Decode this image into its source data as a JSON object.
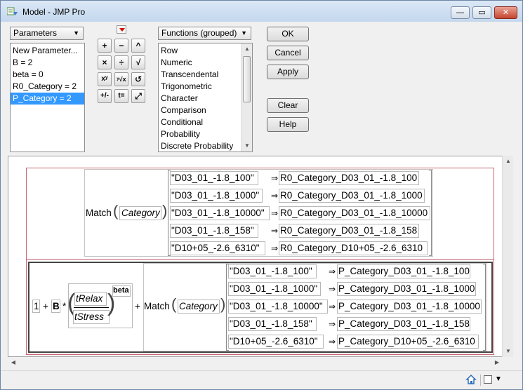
{
  "window": {
    "title": "Model - JMP Pro",
    "minimize": "—",
    "maximize": "▭",
    "close": "✕"
  },
  "left_panel": {
    "dropdown": "Parameters",
    "items": [
      "New Parameter...",
      "B = 2",
      "beta = 0",
      "R0_Category = 2",
      "P_Category = 2"
    ],
    "selected_index": 4
  },
  "functions_panel": {
    "dropdown": "Functions (grouped)",
    "items": [
      "Row",
      "Numeric",
      "Transcendental",
      "Trigonometric",
      "Character",
      "Comparison",
      "Conditional",
      "Probability",
      "Discrete Probability"
    ]
  },
  "toolbar": {
    "buttons": [
      "+",
      "−",
      "^",
      "×",
      "÷",
      "√",
      "xʸ",
      "ʸ√x",
      "↺",
      "+/-",
      "t=",
      "⤢"
    ]
  },
  "buttons": {
    "ok": "OK",
    "cancel": "Cancel",
    "apply": "Apply",
    "clear": "Clear",
    "help": "Help"
  },
  "formula": {
    "match_label": "Match",
    "category_column": "Category",
    "arrow": "⇒",
    "match1": [
      {
        "key": "\"D03_01_-1.8_100\"",
        "value": "R0_Category_D03_01_-1.8_100"
      },
      {
        "key": "\"D03_01_-1.8_1000\"",
        "value": "R0_Category_D03_01_-1.8_1000"
      },
      {
        "key": "\"D03_01_-1.8_10000\"",
        "value": "R0_Category_D03_01_-1.8_10000"
      },
      {
        "key": "\"D03_01_-1.8_158\"",
        "value": "R0_Category_D03_01_-1.8_158"
      },
      {
        "key": "\"D10+05_-2.6_6310\"",
        "value": "R0_Category_D10+05_-2.6_6310"
      }
    ],
    "one": "1",
    "plus": "+",
    "b_param": "B",
    "times": "*",
    "numerator": "tRelax",
    "denominator": "tStress",
    "exponent": "beta",
    "match2": [
      {
        "key": "\"D03_01_-1.8_100\"",
        "value": "P_Category_D03_01_-1.8_100"
      },
      {
        "key": "\"D03_01_-1.8_1000\"",
        "value": "P_Category_D03_01_-1.8_1000"
      },
      {
        "key": "\"D03_01_-1.8_10000\"",
        "value": "P_Category_D03_01_-1.8_10000"
      },
      {
        "key": "\"D03_01_-1.8_158\"",
        "value": "P_Category_D03_01_-1.8_158"
      },
      {
        "key": "\"D10+05_-2.6_6310\"",
        "value": "P_Category_D10+05_-2.6_6310"
      }
    ]
  },
  "statusbar": {
    "home_icon": "home-icon",
    "window_icon": "window-list-icon"
  }
}
